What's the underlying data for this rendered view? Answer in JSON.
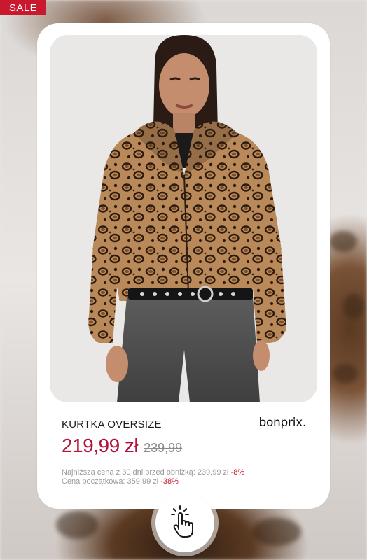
{
  "badge": {
    "label": "SALE"
  },
  "product": {
    "name": "KURTKA OVERSIZE",
    "brand": "bonprix.",
    "price_current": "219,99 zł",
    "price_old": "239,99",
    "lowest_price_text": "Najniższa cena z 30 dni  przed obniżką: 239,99 zł ",
    "lowest_price_discount": "-8%",
    "initial_price_text": "Cena początkowa: 359,99 zł ",
    "initial_price_discount": "-38%"
  },
  "colors": {
    "sale_badge": "#c8192e",
    "price": "#b0143c",
    "discount": "#c8192e"
  },
  "icons": {
    "tap": "tap-hand-icon"
  }
}
